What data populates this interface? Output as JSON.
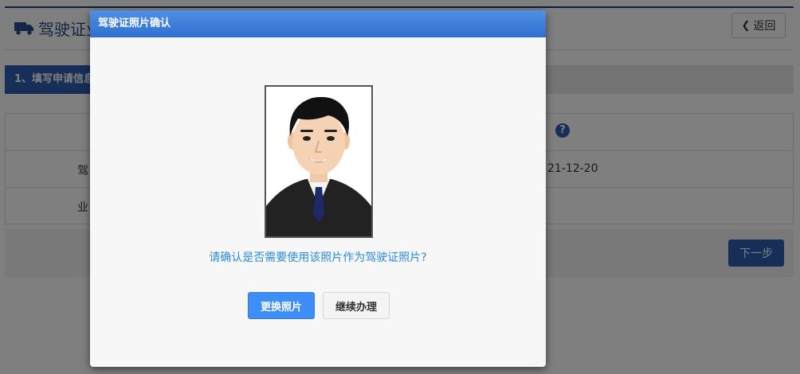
{
  "header": {
    "title": "驾驶证业",
    "back_label": "返回"
  },
  "steps": {
    "active_label": "1、填写申请信息"
  },
  "form": {
    "row1_label": "驾",
    "row1_value": "21-12-20",
    "row2_label": "业"
  },
  "actions": {
    "next_label": "下一步"
  },
  "modal": {
    "title": "驾驶证照片确认",
    "confirm_text": "请确认是否需要使用该照片作为驾驶证照片?",
    "change_photo_label": "更换照片",
    "continue_label": "继续办理"
  },
  "colors": {
    "primary": "#2c5db0",
    "modal_header": "#3d7fe0",
    "link_text": "#2a8bd8"
  },
  "icons": [
    "truck-icon",
    "chevron-left-icon",
    "help-icon"
  ]
}
